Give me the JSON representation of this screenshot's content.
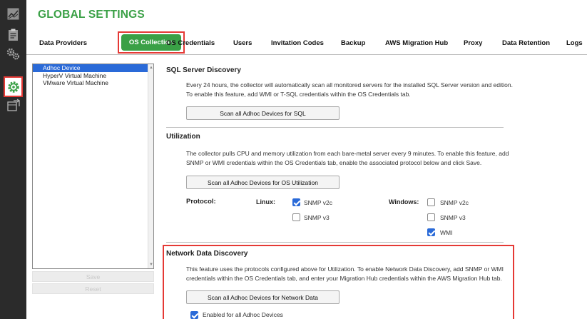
{
  "header": {
    "title": "GLOBAL SETTINGS"
  },
  "sidebar": {
    "icons": [
      "chart-icon",
      "clipboard-icon",
      "gears-icon",
      "settings-icon",
      "migration-icon"
    ]
  },
  "tabs": [
    {
      "label": "Data Providers"
    },
    {
      "label": "OS Collection",
      "active": true
    },
    {
      "label": "OS Credentials"
    },
    {
      "label": "Users"
    },
    {
      "label": "Invitation Codes"
    },
    {
      "label": "Backup"
    },
    {
      "label": "AWS Migration Hub"
    },
    {
      "label": "Proxy"
    },
    {
      "label": "Data Retention"
    },
    {
      "label": "Logs"
    }
  ],
  "device_list": {
    "items": [
      "Adhoc Device",
      "HyperV Virtual Machine",
      "VMware Virtual Machine"
    ],
    "selected": "Adhoc Device",
    "save_label": "Save",
    "reset_label": "Reset"
  },
  "sql": {
    "title": "SQL Server Discovery",
    "line1": "Every 24 hours, the collector will automatically scan all monitored servers for the installed SQL Server version and edition.",
    "line2": "To enable this feature, add WMI or T-SQL credentials within the OS Credentials tab.",
    "button": "Scan all Adhoc Devices for SQL"
  },
  "utilization": {
    "title": "Utilization",
    "line1": "The collector pulls CPU and memory utilization from each bare-metal server every 9 minutes. To enable this feature, add",
    "line2": "SNMP or WMI credentials within the OS Credentials tab, enable the associated protocol below and click Save.",
    "button": "Scan all Adhoc Devices for OS Utilization",
    "protocol_label": "Protocol:",
    "linux_label": "Linux:",
    "windows_label": "Windows:",
    "linux": [
      {
        "label": "SNMP v2c",
        "checked": true
      },
      {
        "label": "SNMP v3",
        "checked": false
      }
    ],
    "windows": [
      {
        "label": "SNMP v2c",
        "checked": false
      },
      {
        "label": "SNMP v3",
        "checked": false
      },
      {
        "label": "WMI",
        "checked": true
      }
    ]
  },
  "network": {
    "title": "Network Data Discovery",
    "line1": "This feature uses the protocols configured above for Utilization. To enable Network Data Discovery, add SNMP or WMI",
    "line2": "credentials within the OS Credentials tab, and enter your Migration Hub credentials within the AWS Migration Hub tab.",
    "button": "Scan all Adhoc Devices for Network Data",
    "enabled_label": "Enabled for all Adhoc Devices",
    "enabled": true
  },
  "colors": {
    "brand_green": "#3aa046",
    "selection_blue": "#2a6ad8",
    "highlight_red": "#e53935",
    "sidebar_dark": "#2b2b2b"
  }
}
